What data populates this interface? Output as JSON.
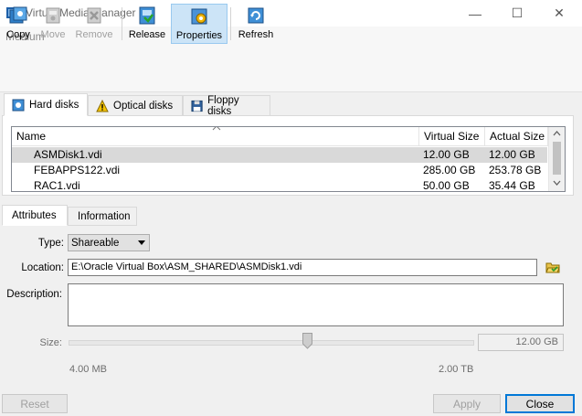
{
  "window": {
    "title": "Virtual Media Manager",
    "minimize": "—",
    "maximize": "☐",
    "close": "✕"
  },
  "menu": {
    "medium": "Medium"
  },
  "toolbar": {
    "copy": "Copy",
    "move": "Move",
    "remove": "Remove",
    "release": "Release",
    "properties": "Properties",
    "refresh": "Refresh"
  },
  "media_tabs": {
    "hard_disks": "Hard disks",
    "optical_disks": "Optical disks",
    "floppy_disks": "Floppy disks"
  },
  "table": {
    "columns": [
      "Name",
      "Virtual Size",
      "Actual Size"
    ],
    "rows": [
      [
        "ASMDisk1.vdi",
        "12.00 GB",
        "12.00 GB"
      ],
      [
        "FEBAPPS122.vdi",
        "285.00 GB",
        "253.78 GB"
      ],
      [
        "RAC1.vdi",
        "50.00 GB",
        "35.44 GB"
      ]
    ]
  },
  "info_tabs": {
    "attributes": "Attributes",
    "information": "Information"
  },
  "attributes": {
    "type_label": "Type:",
    "type_value": "Shareable",
    "location_label": "Location:",
    "location_value": "E:\\Oracle Virtual Box\\ASM_SHARED\\ASMDisk1.vdi",
    "description_label": "Description:",
    "description_value": "",
    "size_label": "Size:",
    "size_value": "12.00 GB",
    "size_min": "4.00 MB",
    "size_max": "2.00 TB",
    "size_slider_fraction": 0.59
  },
  "buttons": {
    "reset": "Reset",
    "apply": "Apply",
    "close": "Close"
  },
  "colors": {
    "selection": "#d9d9d9",
    "active_tool": "#cce4f7",
    "accent": "#0078d7"
  }
}
